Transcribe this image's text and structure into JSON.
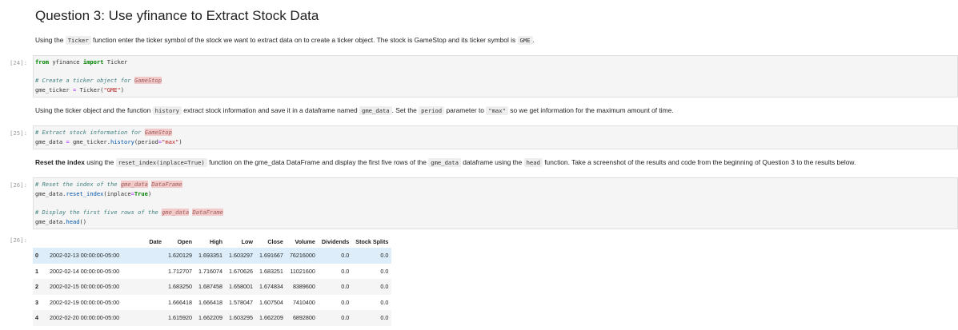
{
  "heading": "Question 3: Use yfinance to Extract Stock Data",
  "md1": {
    "t1": "Using the",
    "c1": "Ticker",
    "t2": "function enter the ticker symbol of the stock we want to extract data on to create a ticker object. The stock is GameStop and its ticker symbol is",
    "c2": "GME",
    "t3": "."
  },
  "md2": {
    "t1": "Using the ticker object and the function",
    "c1": "history",
    "t2": "extract stock information and save it in a dataframe named",
    "c2": "gme_data",
    "t3": ". Set the",
    "c3": "period",
    "t4": "parameter to",
    "c4": "\"max\"",
    "t5": "so we get information for the maximum amount of time."
  },
  "md3": {
    "b1": "Reset the index",
    "t1": "using the",
    "c1": "reset_index(inplace=True)",
    "t2": "function on the gme_data DataFrame and display the first five rows of the",
    "c2": "gme_data",
    "t3": "dataframe using the",
    "c3": "head",
    "t4": "function. Take a screenshot of the results and code from the beginning of Question 3 to the results below."
  },
  "prompts": {
    "p1": "[24]:",
    "p2": "[25]:",
    "p3": "[26]:",
    "p4": "[26]:"
  },
  "code1": {
    "l1_kw1": "from",
    "l1_mod": " yfinance ",
    "l1_kw2": "import",
    "l1_name": " Ticker",
    "l2_c": "# Create a ticker object for ",
    "l2_hl": "GameStop",
    "l3_a": "gme_ticker ",
    "l3_op": "=",
    "l3_b": " Ticker(",
    "l3_s": "\"GME\"",
    "l3_c": ")"
  },
  "code2": {
    "l1_c": "# Extract stock information for ",
    "l1_hl": "GameStop",
    "l2_a": "gme_data ",
    "l2_op": "=",
    "l2_b": " gme_ticker.",
    "l2_f": "history",
    "l2_c": "(period",
    "l2_op2": "=",
    "l2_s": "\"max\"",
    "l2_d": ")"
  },
  "code3": {
    "l1_c": "# Reset the index of the ",
    "l1_hl1": "gme_data",
    "l1_sp": " ",
    "l1_hl2": "DataFrame",
    "l2_a": "gme_data.",
    "l2_f": "reset_index",
    "l2_b": "(inplace",
    "l2_op": "=",
    "l2_kw": "True",
    "l2_c": ")",
    "l3_c": "# Display the first five rows of the ",
    "l3_hl1": "gme_data",
    "l3_sp": " ",
    "l3_hl2": "DataFrame",
    "l4_a": "gme_data.",
    "l4_f": "head",
    "l4_b": "()"
  },
  "table": {
    "columns": [
      "",
      "Date",
      "Open",
      "High",
      "Low",
      "Close",
      "Volume",
      "Dividends",
      "Stock Splits"
    ],
    "rows": [
      [
        "0",
        "2002-02-13 00:00:00-05:00",
        "1.620129",
        "1.693351",
        "1.603297",
        "1.691667",
        "76216000",
        "0.0",
        "0.0"
      ],
      [
        "1",
        "2002-02-14 00:00:00-05:00",
        "1.712707",
        "1.716074",
        "1.670626",
        "1.683251",
        "11021600",
        "0.0",
        "0.0"
      ],
      [
        "2",
        "2002-02-15 00:00:00-05:00",
        "1.683250",
        "1.687458",
        "1.658001",
        "1.674834",
        "8389600",
        "0.0",
        "0.0"
      ],
      [
        "3",
        "2002-02-19 00:00:00-05:00",
        "1.666418",
        "1.666418",
        "1.578047",
        "1.607504",
        "7410400",
        "0.0",
        "0.0"
      ],
      [
        "4",
        "2002-02-20 00:00:00-05:00",
        "1.615920",
        "1.662209",
        "1.603295",
        "1.662209",
        "6892800",
        "0.0",
        "0.0"
      ]
    ]
  }
}
